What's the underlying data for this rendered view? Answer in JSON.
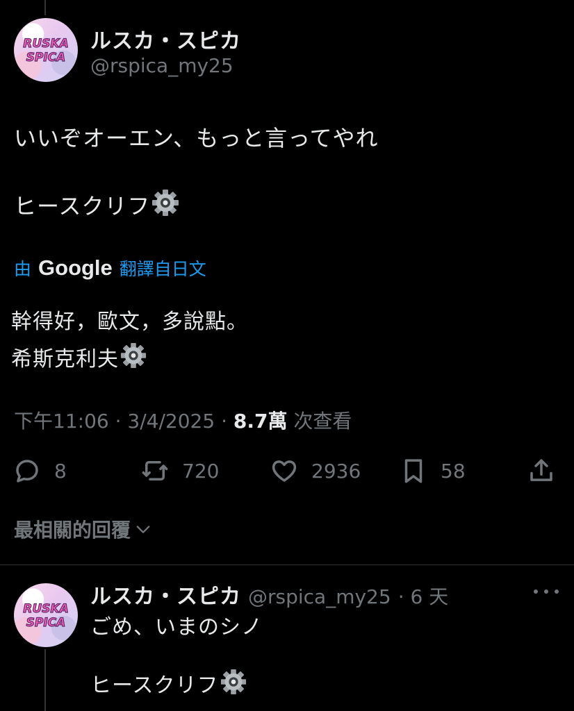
{
  "tweet": {
    "author_name": "ルスカ・スピカ",
    "author_handle": "@rspica_my25",
    "avatar_text": "RUSKA SPICA",
    "text_line1": "いいぞオーエン、もっと言ってやれ",
    "text_line2": "ヒースクリフ",
    "translation": {
      "prefix": "由",
      "brand": "Google",
      "suffix": "翻譯自日文",
      "line1": "幹得好，歐文，多說點。",
      "line2": "希斯克利夫"
    },
    "meta": {
      "time": "下午11:06",
      "sep1": " · ",
      "date": "3/4/2025",
      "sep2": " · ",
      "views_count": "8.7萬",
      "views_label": " 次查看"
    },
    "actions": {
      "replies": "8",
      "reposts": "720",
      "likes": "2936",
      "bookmarks": "58"
    },
    "replies_sort_label": "最相關的回覆"
  },
  "reply": {
    "author_name": "ルスカ・スピカ",
    "author_handle": "@rspica_my25",
    "time": "· 6 天",
    "text_line1": "ごめ、いまのシノ",
    "text_line2": "ヒースクリフ"
  },
  "colors": {
    "background": "#000000",
    "text_primary": "#e7e9ea",
    "text_secondary": "#71767b",
    "link_blue": "#1d9bf0"
  },
  "icons": [
    "reply-icon",
    "repost-icon",
    "like-icon",
    "bookmark-icon",
    "share-icon",
    "gear-emoji-icon",
    "chevron-down-icon",
    "more-icon"
  ]
}
